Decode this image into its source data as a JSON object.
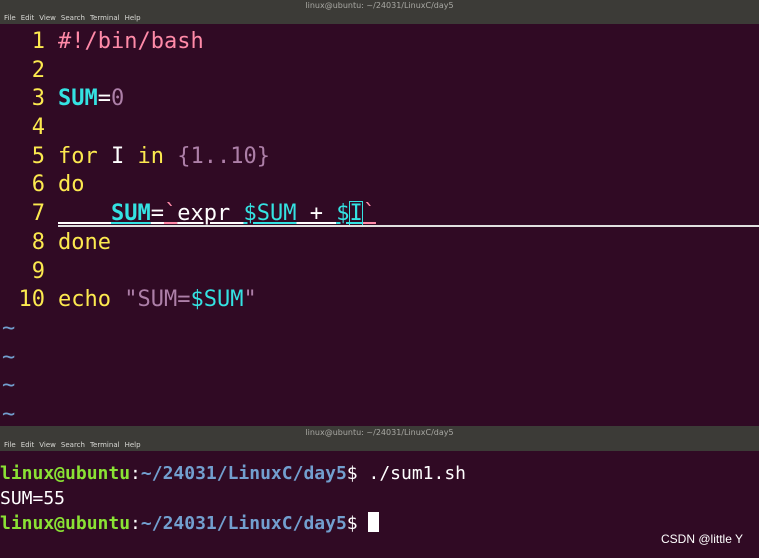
{
  "top_window": {
    "title": "linux@ubuntu: ~/24031/LinuxC/day5",
    "menu": [
      "File",
      "Edit",
      "View",
      "Search",
      "Terminal",
      "Help"
    ],
    "lines": [
      {
        "n": "1",
        "text": "#!/bin/bash"
      },
      {
        "n": "2",
        "text": ""
      },
      {
        "n": "3",
        "var": "SUM",
        "eq": "=",
        "num": "0"
      },
      {
        "n": "4",
        "text": ""
      },
      {
        "n": "5",
        "kw_for": "for",
        "mid": " I ",
        "kw_in": "in",
        "brace_open": " {",
        "n1": "1",
        "dots": "..",
        "n2": "10",
        "brace_close": "}"
      },
      {
        "n": "6",
        "kw": "do"
      },
      {
        "n": "7",
        "indent": "    ",
        "var": "SUM",
        "eq": "=",
        "tick1": "`",
        "cmd": "expr ",
        "v1": "$SUM",
        "plus": " + ",
        "dollar": "$",
        "cur": "I",
        "tick2": "`"
      },
      {
        "n": "8",
        "kw": "done"
      },
      {
        "n": "9",
        "text": ""
      },
      {
        "n": "10",
        "kw": "echo",
        "str_q1": " \"SUM=",
        "str_var": "$SUM",
        "str_q2": "\""
      }
    ],
    "tilde": "~"
  },
  "bottom_window": {
    "title": "linux@ubuntu: ~/24031/LinuxC/day5",
    "menu": [
      "File",
      "Edit",
      "View",
      "Search",
      "Terminal",
      "Help"
    ],
    "prompt_user": "linux@ubuntu",
    "prompt_colon": ":",
    "prompt_path": "~/24031/LinuxC/day5",
    "prompt_symbol": "$ ",
    "command": "./sum1.sh",
    "output": "SUM=55"
  },
  "watermark": "CSDN @little Y"
}
